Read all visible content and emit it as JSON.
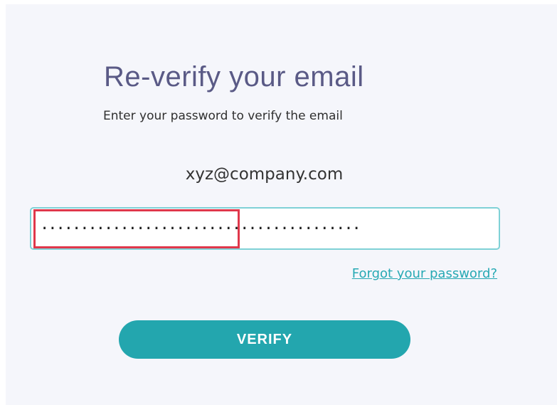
{
  "title": "Re-verify your email",
  "subtitle": "Enter your password to verify the email",
  "email": "xyz@company.com",
  "password": {
    "value": "········································"
  },
  "forgot_link": "Forgot your password?",
  "verify_button": "VERIFY",
  "colors": {
    "title": "#5a5a86",
    "accent": "#23a6ae",
    "input_border": "#7fd1d6",
    "highlight": "#e0374b",
    "background": "#f5f6fb"
  }
}
